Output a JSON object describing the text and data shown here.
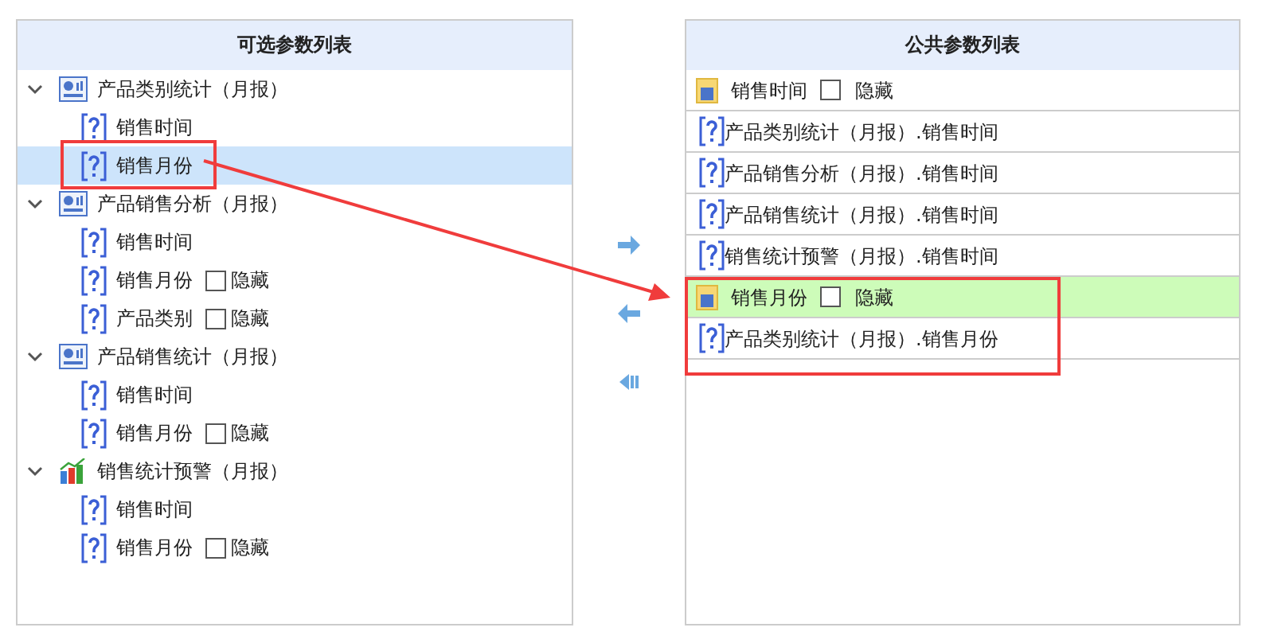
{
  "available_panel": {
    "title": "可选参数列表",
    "groups": [
      {
        "label": "产品类别统计（月报）",
        "kind": "report",
        "expanded": true,
        "children": [
          {
            "label": "销售时间",
            "selected": false
          },
          {
            "label": "销售月份",
            "selected": true
          }
        ]
      },
      {
        "label": "产品销售分析（月报）",
        "kind": "report",
        "expanded": true,
        "children": [
          {
            "label": "销售时间",
            "selected": false
          },
          {
            "label": "销售月份",
            "selected": false,
            "hide_option": {
              "label": "隐藏",
              "checked": false
            }
          },
          {
            "label": "产品类别",
            "selected": false,
            "hide_option": {
              "label": "隐藏",
              "checked": false
            }
          }
        ]
      },
      {
        "label": "产品销售统计（月报）",
        "kind": "report",
        "expanded": true,
        "children": [
          {
            "label": "销售时间",
            "selected": false
          },
          {
            "label": "销售月份",
            "selected": false,
            "hide_option": {
              "label": "隐藏",
              "checked": false
            }
          }
        ]
      },
      {
        "label": "销售统计预警（月报）",
        "kind": "chart",
        "expanded": true,
        "children": [
          {
            "label": "销售时间",
            "selected": false
          },
          {
            "label": "销售月份",
            "selected": false,
            "hide_option": {
              "label": "隐藏",
              "checked": false
            }
          }
        ]
      }
    ]
  },
  "public_panel": {
    "title": "公共参数列表",
    "rows": [
      {
        "kind": "group",
        "label": "销售时间",
        "hide_option": {
          "label": "隐藏",
          "checked": false
        },
        "selected": false
      },
      {
        "kind": "param",
        "label": "产品类别统计（月报）.销售时间"
      },
      {
        "kind": "param",
        "label": "产品销售分析（月报）.销售时间"
      },
      {
        "kind": "param",
        "label": "产品销售统计（月报）.销售时间"
      },
      {
        "kind": "param",
        "label": "销售统计预警（月报）.销售时间"
      },
      {
        "kind": "group",
        "label": "销售月份",
        "hide_option": {
          "label": "隐藏",
          "checked": false
        },
        "selected": true
      },
      {
        "kind": "param",
        "label": "产品类别统计（月报）.销售月份"
      }
    ]
  }
}
